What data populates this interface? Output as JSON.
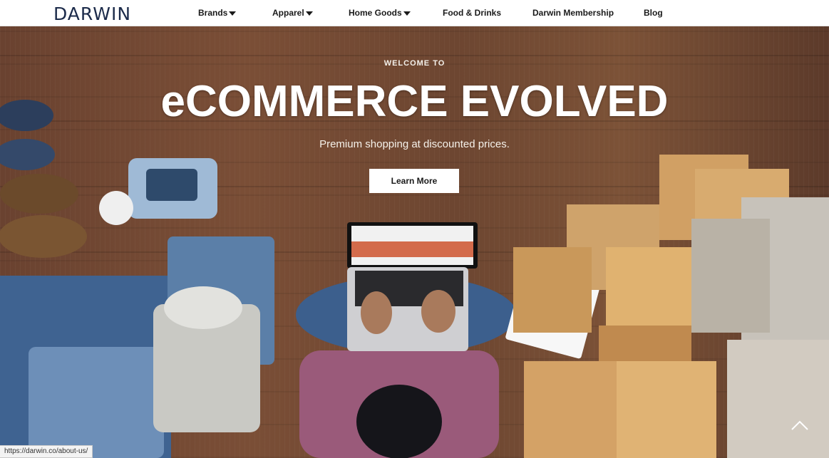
{
  "brand": {
    "logo_text": "DARWIN"
  },
  "nav": {
    "items": [
      {
        "label": "Brands",
        "has_dropdown": true
      },
      {
        "label": "Apparel",
        "has_dropdown": true
      },
      {
        "label": "Home Goods",
        "has_dropdown": true
      },
      {
        "label": "Food & Drinks",
        "has_dropdown": false
      },
      {
        "label": "Darwin Membership",
        "has_dropdown": false
      },
      {
        "label": "Blog",
        "has_dropdown": false
      }
    ]
  },
  "hero": {
    "eyebrow": "WELCOME TO",
    "headline": "eCOMMERCE EVOLVED",
    "subheadline": "Premium shopping at discounted prices.",
    "cta_label": "Learn More"
  },
  "status": {
    "link_url": "https://darwin.co/about-us/"
  },
  "icons": {
    "dropdown": "caret-down-icon",
    "scroll_top": "chevron-up-icon"
  },
  "colors": {
    "logo": "#1c2b4a",
    "hero_wood": "#6f4632",
    "cta_bg": "#ffffff",
    "box": "#c9985a",
    "denim": "#4a6f9c"
  }
}
